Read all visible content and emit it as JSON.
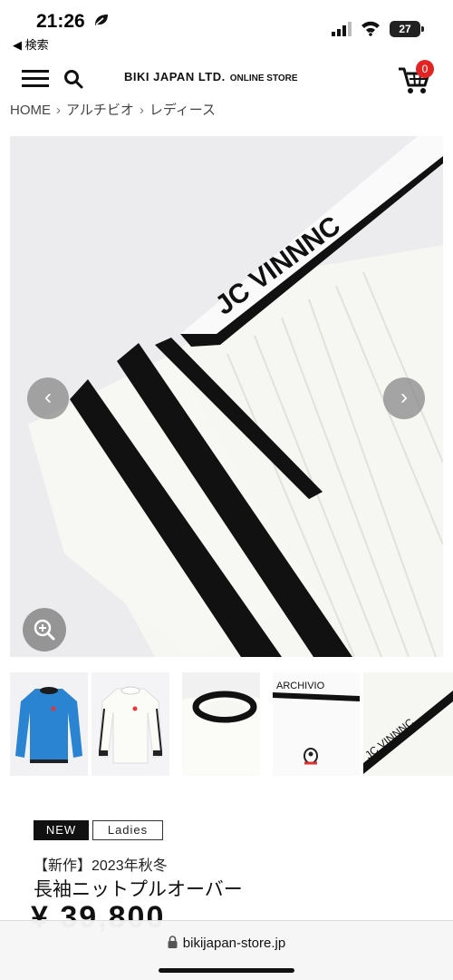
{
  "status_bar": {
    "time": "21:26",
    "back_label": "◀ 検索",
    "battery": "27"
  },
  "header": {
    "logo_main": "BIKI JAPAN LTD.",
    "logo_sub": "ONLINE STORE",
    "cart_count": "0"
  },
  "breadcrumb": {
    "items": [
      "HOME",
      "アルチビオ",
      "レディース"
    ],
    "separator": "›"
  },
  "gallery": {
    "prev_label": "‹",
    "next_label": "›",
    "thumbnails": [
      "blue-pullover",
      "white-pullover",
      "collar-detail",
      "logo-detail",
      "sleeve-detail"
    ]
  },
  "product": {
    "tags": [
      "NEW",
      "Ladies"
    ],
    "series": "【新作】2023年秋冬",
    "name": "長袖ニットプルオーバー",
    "price": "¥ 39,800"
  },
  "browser": {
    "url": "bikijapan-store.jp"
  },
  "colors": {
    "accent": "#e02424",
    "tag_bg": "#111111",
    "hero_bg": "#ececee"
  }
}
